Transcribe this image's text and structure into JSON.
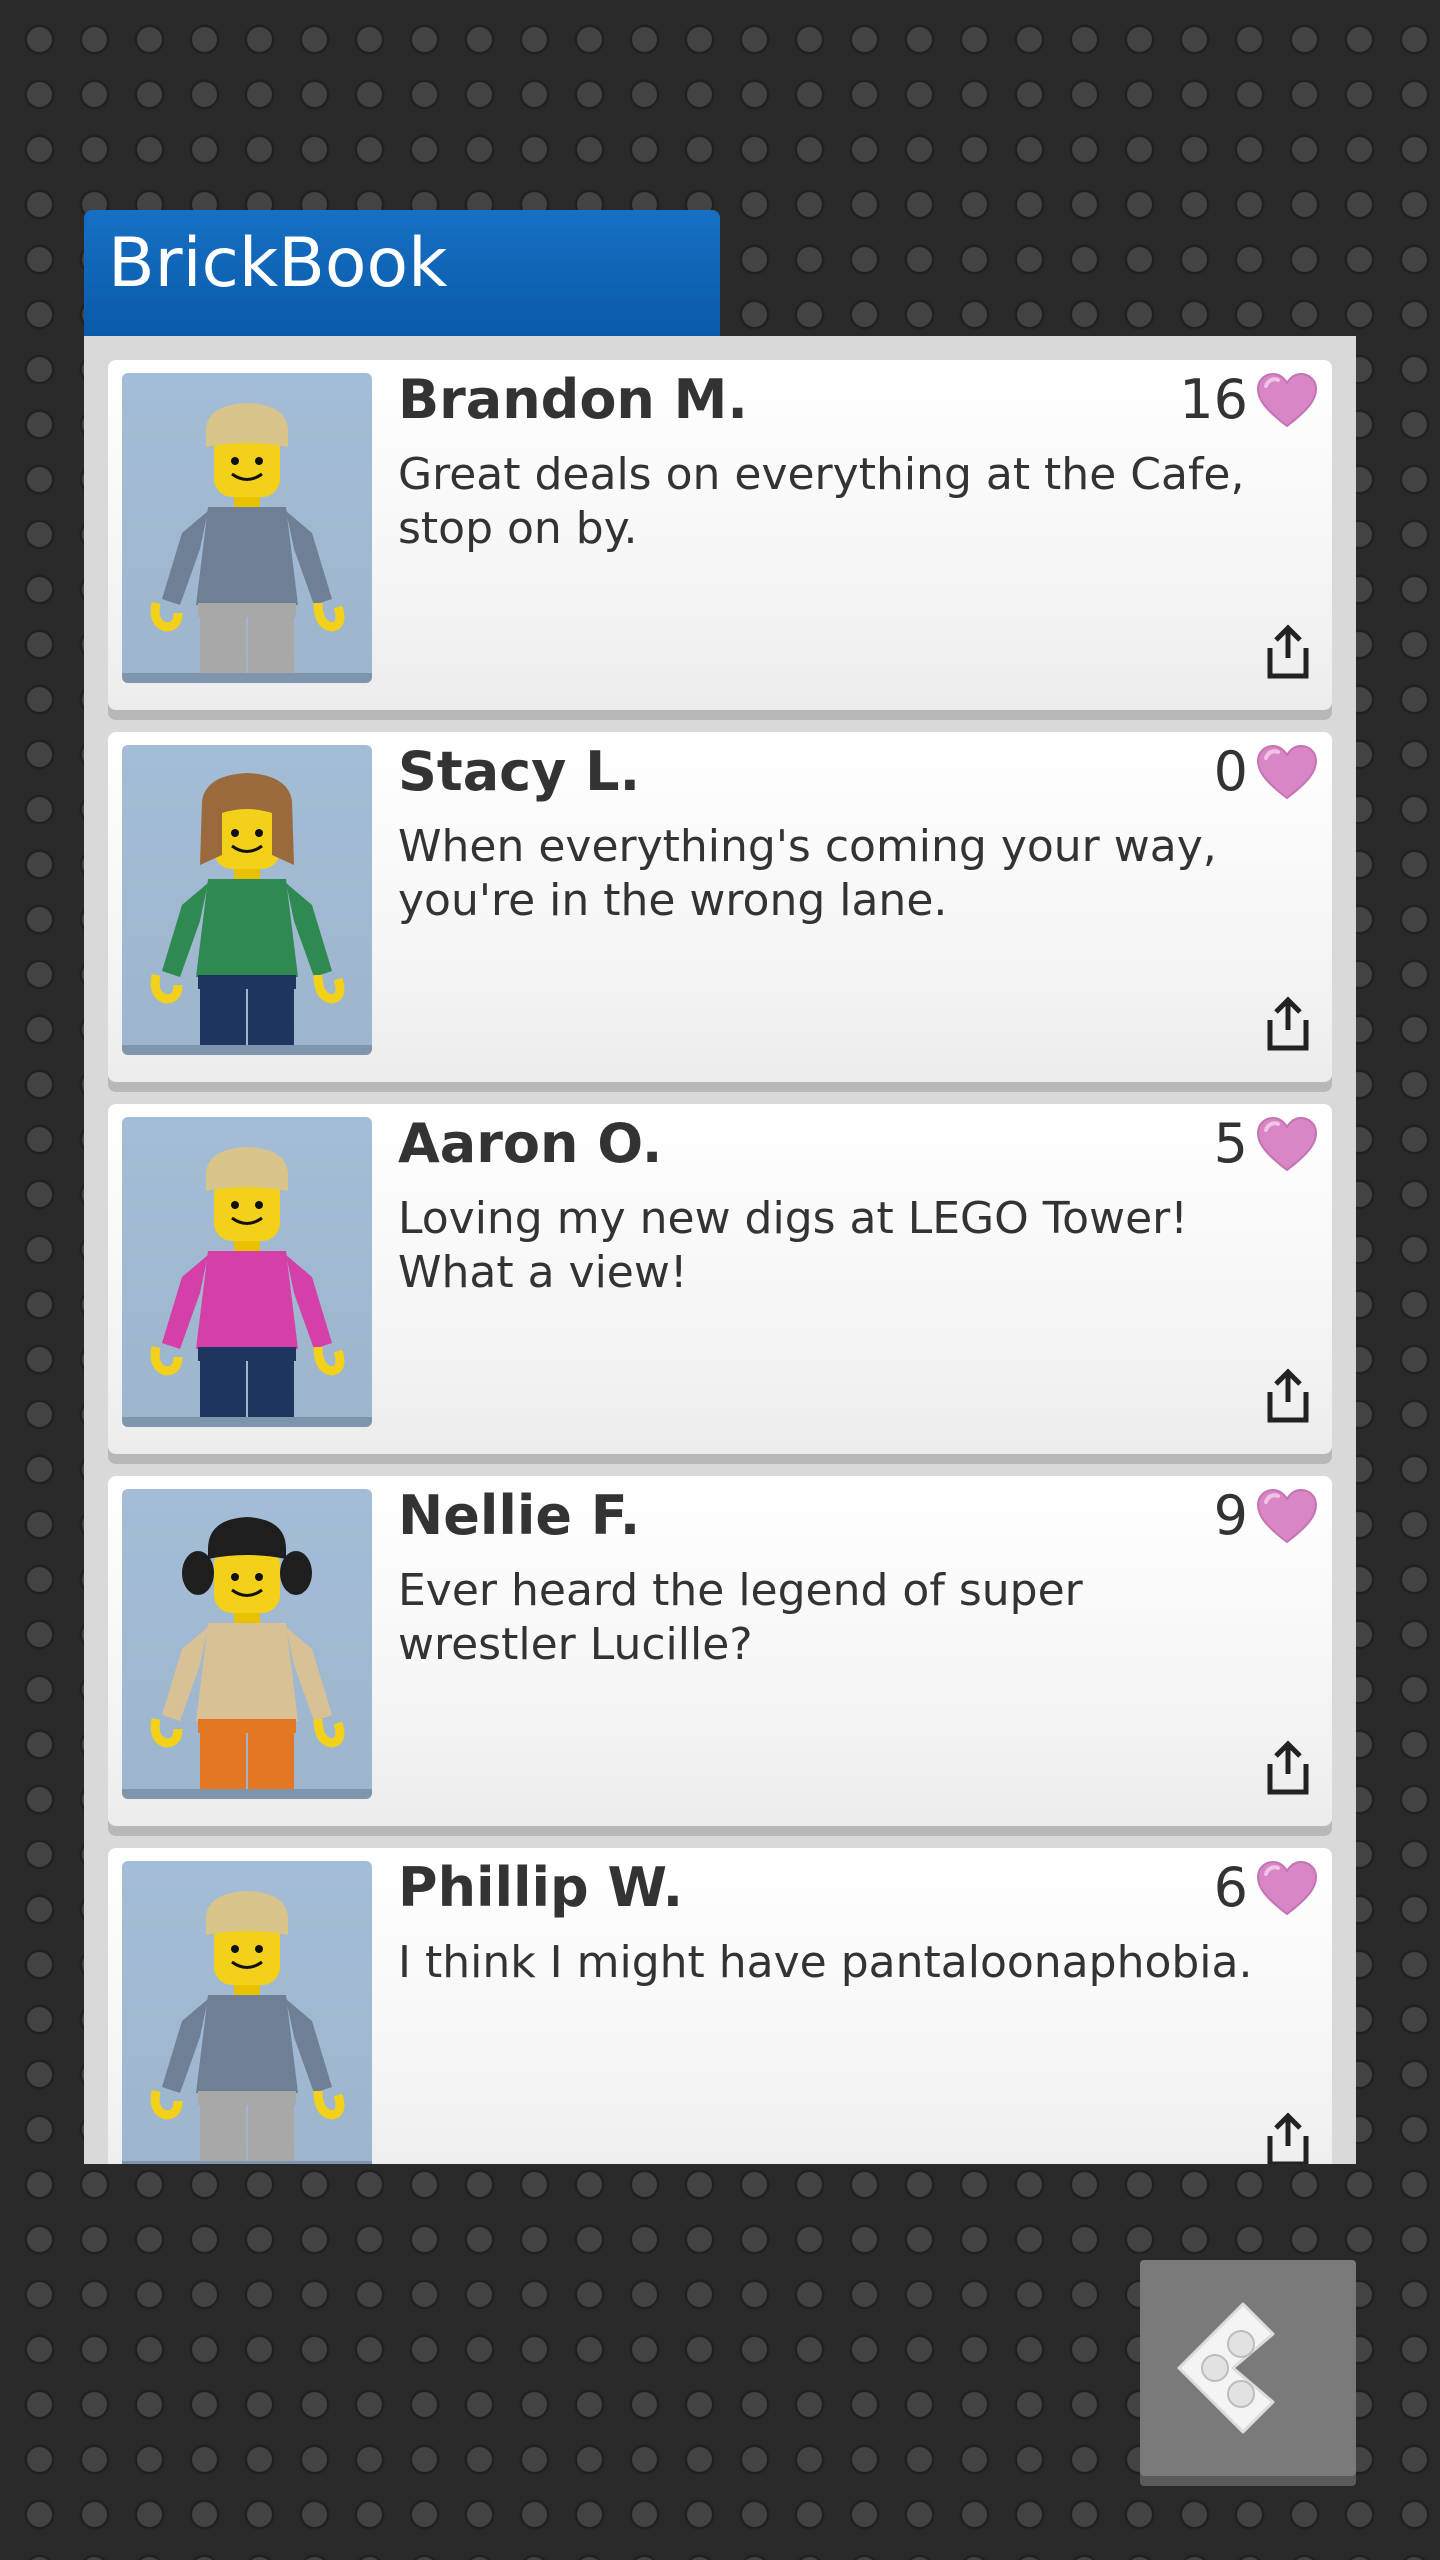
{
  "app": {
    "title": "BrickBook"
  },
  "colors": {
    "title_bar": "#0a5aa8",
    "heart": "#d986c6",
    "panel": "#d9d9d9",
    "background": "#2a2a2a"
  },
  "posts": [
    {
      "name": "Brandon M.",
      "likes": "16",
      "message": "Great deals on everything at the Cafe, stop on by.",
      "avatar": {
        "hair": "#d9c48a",
        "torso": "#6f7f96",
        "legs": "#a8a8a8",
        "style": "short"
      }
    },
    {
      "name": "Stacy L.",
      "likes": "0",
      "message": "When everything's coming your way, you're in the wrong lane.",
      "avatar": {
        "hair": "#9a6a3c",
        "torso": "#2f8a52",
        "legs": "#1e3560",
        "style": "long"
      }
    },
    {
      "name": "Aaron O.",
      "likes": "5",
      "message": "Loving my new digs at LEGO Tower! What a view!",
      "avatar": {
        "hair": "#d9c48a",
        "torso": "#d53fa8",
        "legs": "#1e3560",
        "style": "short"
      }
    },
    {
      "name": "Nellie F.",
      "likes": "9",
      "message": "Ever heard the legend of super wrestler Lucille?",
      "avatar": {
        "hair": "#1e1e1e",
        "torso": "#d8c195",
        "legs": "#e37722",
        "style": "pigtails"
      }
    },
    {
      "name": "Phillip W.",
      "likes": "6",
      "message": "I think I might have pantaloonaphobia.",
      "avatar": {
        "hair": "#d9c48a",
        "torso": "#6f7f96",
        "legs": "#a8a8a8",
        "style": "short"
      }
    }
  ],
  "icons": {
    "like": "heart-icon",
    "share": "share-icon",
    "back": "back-arrow-icon"
  }
}
